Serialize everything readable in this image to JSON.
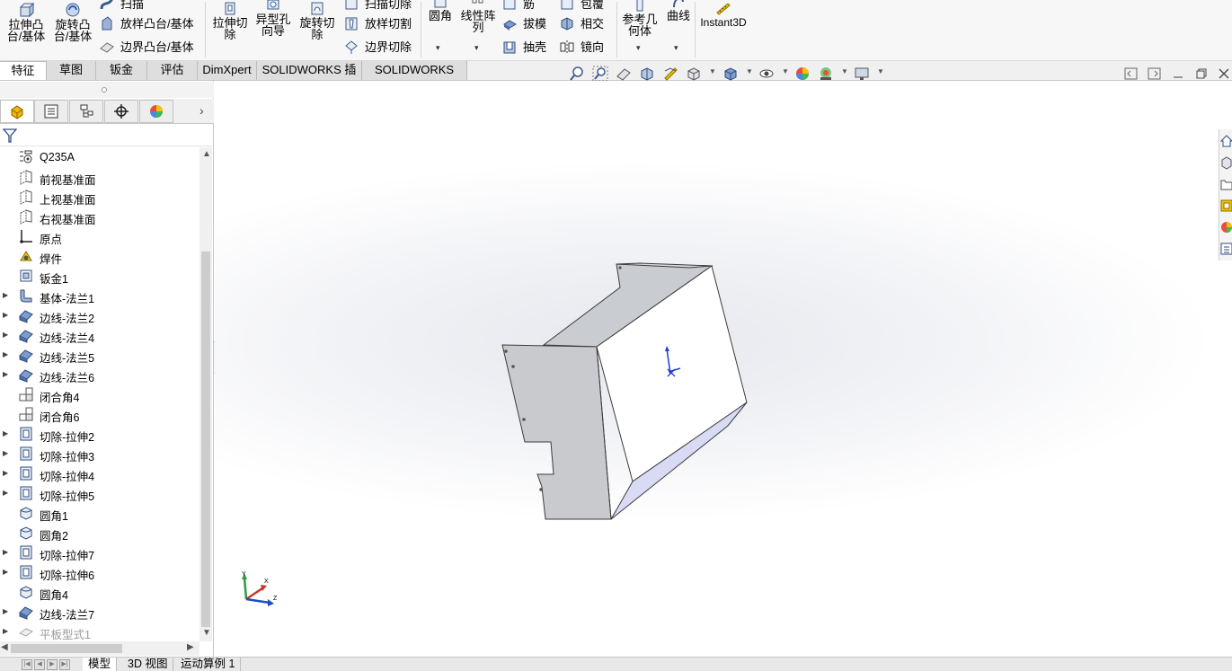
{
  "ribbon": {
    "extrude_boss": "拉伸凸\n台/基体",
    "revolve_boss": "旋转凸\n台/基体",
    "sweep": "扫描",
    "loft_boss": "放样凸台/基体",
    "boundary_boss": "边界凸台/基体",
    "extrude_cut": "拉伸切\n除",
    "hole_wizard": "异型孔\n向导",
    "revolve_cut": "旋转切\n除",
    "swept_cut": "扫描切除",
    "loft_cut": "放样切割",
    "boundary_cut": "边界切除",
    "fillet": "圆角",
    "linear_pattern": "线性阵\n列",
    "rib": "筋",
    "draft": "拔模",
    "shell": "抽壳",
    "wrap": "包覆",
    "intersect": "相交",
    "mirror": "镜向",
    "ref_geometry": "参考几\n何体",
    "curves": "曲线",
    "instant3d": "Instant3D"
  },
  "tabs": [
    "特征",
    "草图",
    "钣金",
    "评估",
    "DimXpert",
    "SOLIDWORKS 插件",
    "SOLIDWORKS MBD"
  ],
  "active_tab": "特征",
  "tree": {
    "items": [
      {
        "label": "Q235A",
        "icon": "material-icon",
        "expandable": false
      },
      {
        "label": "前视基准面",
        "icon": "plane-icon",
        "expandable": false
      },
      {
        "label": "上视基准面",
        "icon": "plane-icon",
        "expandable": false
      },
      {
        "label": "右视基准面",
        "icon": "plane-icon",
        "expandable": false
      },
      {
        "label": "原点",
        "icon": "origin-icon",
        "expandable": false
      },
      {
        "label": "焊件",
        "icon": "weldment-icon",
        "expandable": false
      },
      {
        "label": "钣金1",
        "icon": "sheet-metal-icon",
        "expandable": false
      },
      {
        "label": "基体-法兰1",
        "icon": "base-flange-icon",
        "expandable": true
      },
      {
        "label": "边线-法兰2",
        "icon": "edge-flange-icon",
        "expandable": true
      },
      {
        "label": "边线-法兰4",
        "icon": "edge-flange-icon",
        "expandable": true
      },
      {
        "label": "边线-法兰5",
        "icon": "edge-flange-icon",
        "expandable": true
      },
      {
        "label": "边线-法兰6",
        "icon": "edge-flange-icon",
        "expandable": true
      },
      {
        "label": "闭合角4",
        "icon": "closed-corner-icon",
        "expandable": false
      },
      {
        "label": "闭合角6",
        "icon": "closed-corner-icon",
        "expandable": false
      },
      {
        "label": "切除-拉伸2",
        "icon": "cut-extrude-icon",
        "expandable": true
      },
      {
        "label": "切除-拉伸3",
        "icon": "cut-extrude-icon",
        "expandable": true
      },
      {
        "label": "切除-拉伸4",
        "icon": "cut-extrude-icon",
        "expandable": true
      },
      {
        "label": "切除-拉伸5",
        "icon": "cut-extrude-icon",
        "expandable": true
      },
      {
        "label": "圆角1",
        "icon": "fillet-icon",
        "expandable": false
      },
      {
        "label": "圆角2",
        "icon": "fillet-icon",
        "expandable": false
      },
      {
        "label": "切除-拉伸7",
        "icon": "cut-extrude-icon",
        "expandable": true
      },
      {
        "label": "切除-拉伸6",
        "icon": "cut-extrude-icon",
        "expandable": true
      },
      {
        "label": "圆角4",
        "icon": "fillet-icon",
        "expandable": false
      },
      {
        "label": "边线-法兰7",
        "icon": "edge-flange-icon",
        "expandable": true
      },
      {
        "label": "平板型式1",
        "icon": "flat-pattern-icon",
        "expandable": true,
        "suppressed": true
      }
    ]
  },
  "bottom_tabs": [
    "模型",
    "3D 视图",
    "运动算例 1"
  ],
  "active_bottom_tab": "模型",
  "colors": {
    "accent_blue": "#1f5fbf",
    "model_face_light": "#ffffff",
    "model_face_grey": "#c9ccd0",
    "model_face_lavender": "#d9dbf5",
    "axis_x": "#c0392b",
    "axis_y": "#2e9b3e",
    "axis_z": "#1f4fbf"
  }
}
